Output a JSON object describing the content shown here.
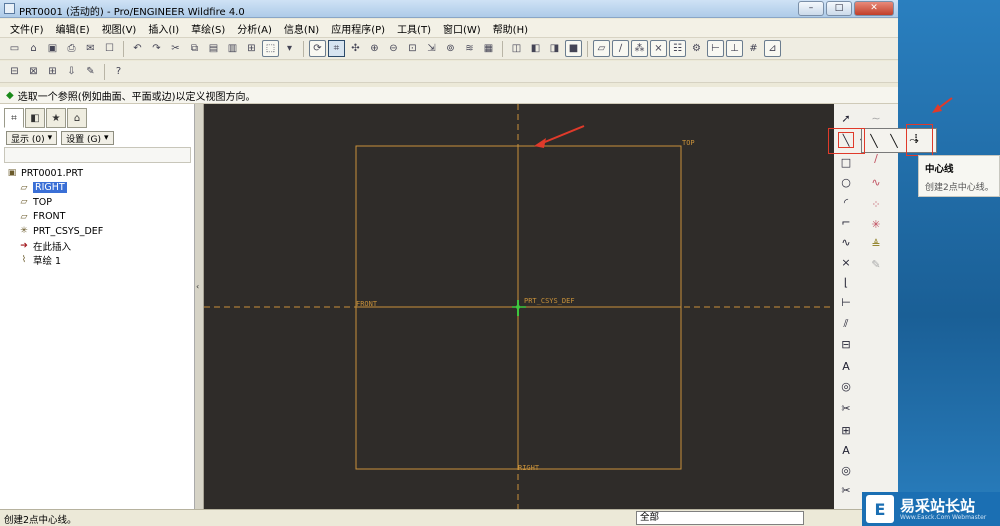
{
  "window": {
    "title": "PRT0001 (活动的) - Pro/ENGINEER Wildfire 4.0",
    "buttons": [
      "–",
      "□",
      "✕"
    ]
  },
  "menu": [
    "文件(F)",
    "编辑(E)",
    "视图(V)",
    "插入(I)",
    "草绘(S)",
    "分析(A)",
    "信息(N)",
    "应用程序(P)",
    "工具(T)",
    "窗口(W)",
    "帮助(H)"
  ],
  "message": "选取一个参照(例如曲面、平面或边)以定义视图方向。",
  "left_panel": {
    "display_button": "显示 (0)",
    "settings_button": "设置 (G)",
    "tree": [
      {
        "label": "PRT0001.PRT",
        "icon": "part-icon",
        "selected": false
      },
      {
        "label": "RIGHT",
        "icon": "datum-plane-icon",
        "selected": true
      },
      {
        "label": "TOP",
        "icon": "datum-plane-icon",
        "selected": false
      },
      {
        "label": "FRONT",
        "icon": "datum-plane-icon",
        "selected": false
      },
      {
        "label": "PRT_CSYS_DEF",
        "icon": "csys-icon",
        "selected": false
      },
      {
        "label": "在此插入",
        "icon": "insert-here-icon",
        "selected": false
      },
      {
        "label": "草绘 1",
        "icon": "sketch-icon",
        "selected": false
      }
    ]
  },
  "canvas": {
    "labels": {
      "top": "TOP",
      "front": "FRONT",
      "csys": "PRT_CSYS_DEF",
      "right": "RIGHT"
    },
    "colors": {
      "background": "#2f2c29",
      "datum": "#c8913a",
      "csys": "#3ec83e"
    }
  },
  "flyout": {
    "tooltip_title": "中心线",
    "tooltip_desc": "创建2点中心线。"
  },
  "status": {
    "text": "创建2点中心线。",
    "filter": "全部"
  },
  "watermark": {
    "name": "易采站长站",
    "sub": "Www.Easck.Com Webmaster",
    "mark": "E"
  }
}
